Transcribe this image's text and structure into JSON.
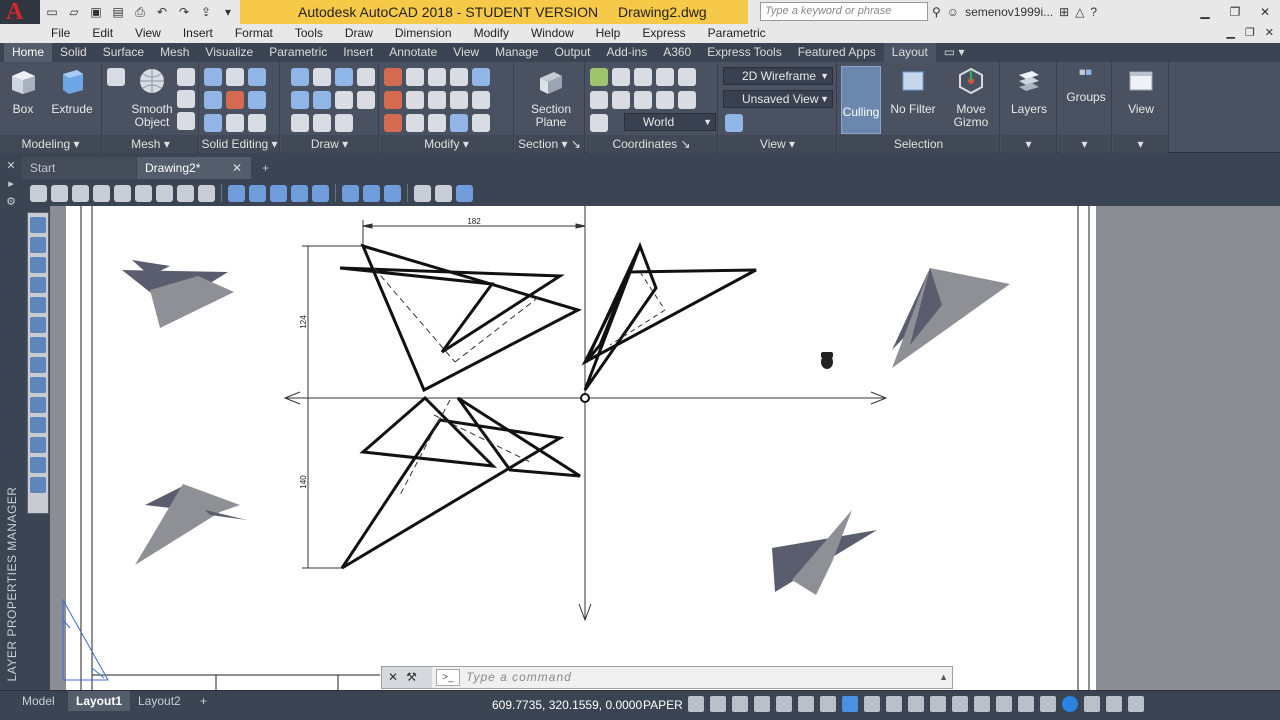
{
  "app": {
    "logo": "A",
    "title": "Autodesk AutoCAD 2018 - STUDENT VERSION",
    "filename": "Drawing2.dwg",
    "search_placeholder": "Type a keyword or phrase",
    "user": "semenov1999i...",
    "help": "?"
  },
  "menu": [
    "File",
    "Edit",
    "View",
    "Insert",
    "Format",
    "Tools",
    "Draw",
    "Dimension",
    "Modify",
    "Window",
    "Help",
    "Express",
    "Parametric"
  ],
  "ribbon_tabs": [
    "Home",
    "Solid",
    "Surface",
    "Mesh",
    "Visualize",
    "Parametric",
    "Insert",
    "Annotate",
    "View",
    "Manage",
    "Output",
    "Add-ins",
    "A360",
    "Express Tools",
    "Featured Apps",
    "Layout"
  ],
  "ribbon": {
    "box": "Box",
    "extrude": "Extrude",
    "smooth_object_1": "Smooth",
    "smooth_object_2": "Object",
    "section_plane_1": "Section",
    "section_plane_2": "Plane",
    "visual_style": "2D Wireframe",
    "saved_view": "Unsaved View",
    "ucs": "World",
    "culling": "Culling",
    "no_filter": "No Filter",
    "move_gizmo_1": "Move",
    "move_gizmo_2": "Gizmo",
    "layers": "Layers",
    "groups": "Groups",
    "view": "View",
    "panels": {
      "modeling": "Modeling",
      "mesh": "Mesh",
      "solid_editing": "Solid Editing",
      "draw": "Draw",
      "modify": "Modify",
      "section": "Section",
      "coordinates": "Coordinates",
      "view": "View",
      "selection": "Selection"
    }
  },
  "file_tabs": {
    "start": "Start",
    "active": "Drawing2*",
    "new": "+"
  },
  "side_panel_label": "LAYER PROPERTIES MANAGER",
  "drawing": {
    "dim_top": "182",
    "dim_left_upper": "124",
    "dim_left_lower": "140"
  },
  "command_line": {
    "placeholder": "Type a command"
  },
  "layout_tabs": [
    "Model",
    "Layout1",
    "Layout2"
  ],
  "status": {
    "coordinates": "609.7735, 320.1559, 0.0000",
    "space": "PAPER"
  },
  "colors": {
    "accent": "#f7c948",
    "ribbon": "#4a5262",
    "culling_active": "#6b87ad",
    "shape_dark": "#5a5d6e",
    "shape_light": "#8e9096"
  }
}
